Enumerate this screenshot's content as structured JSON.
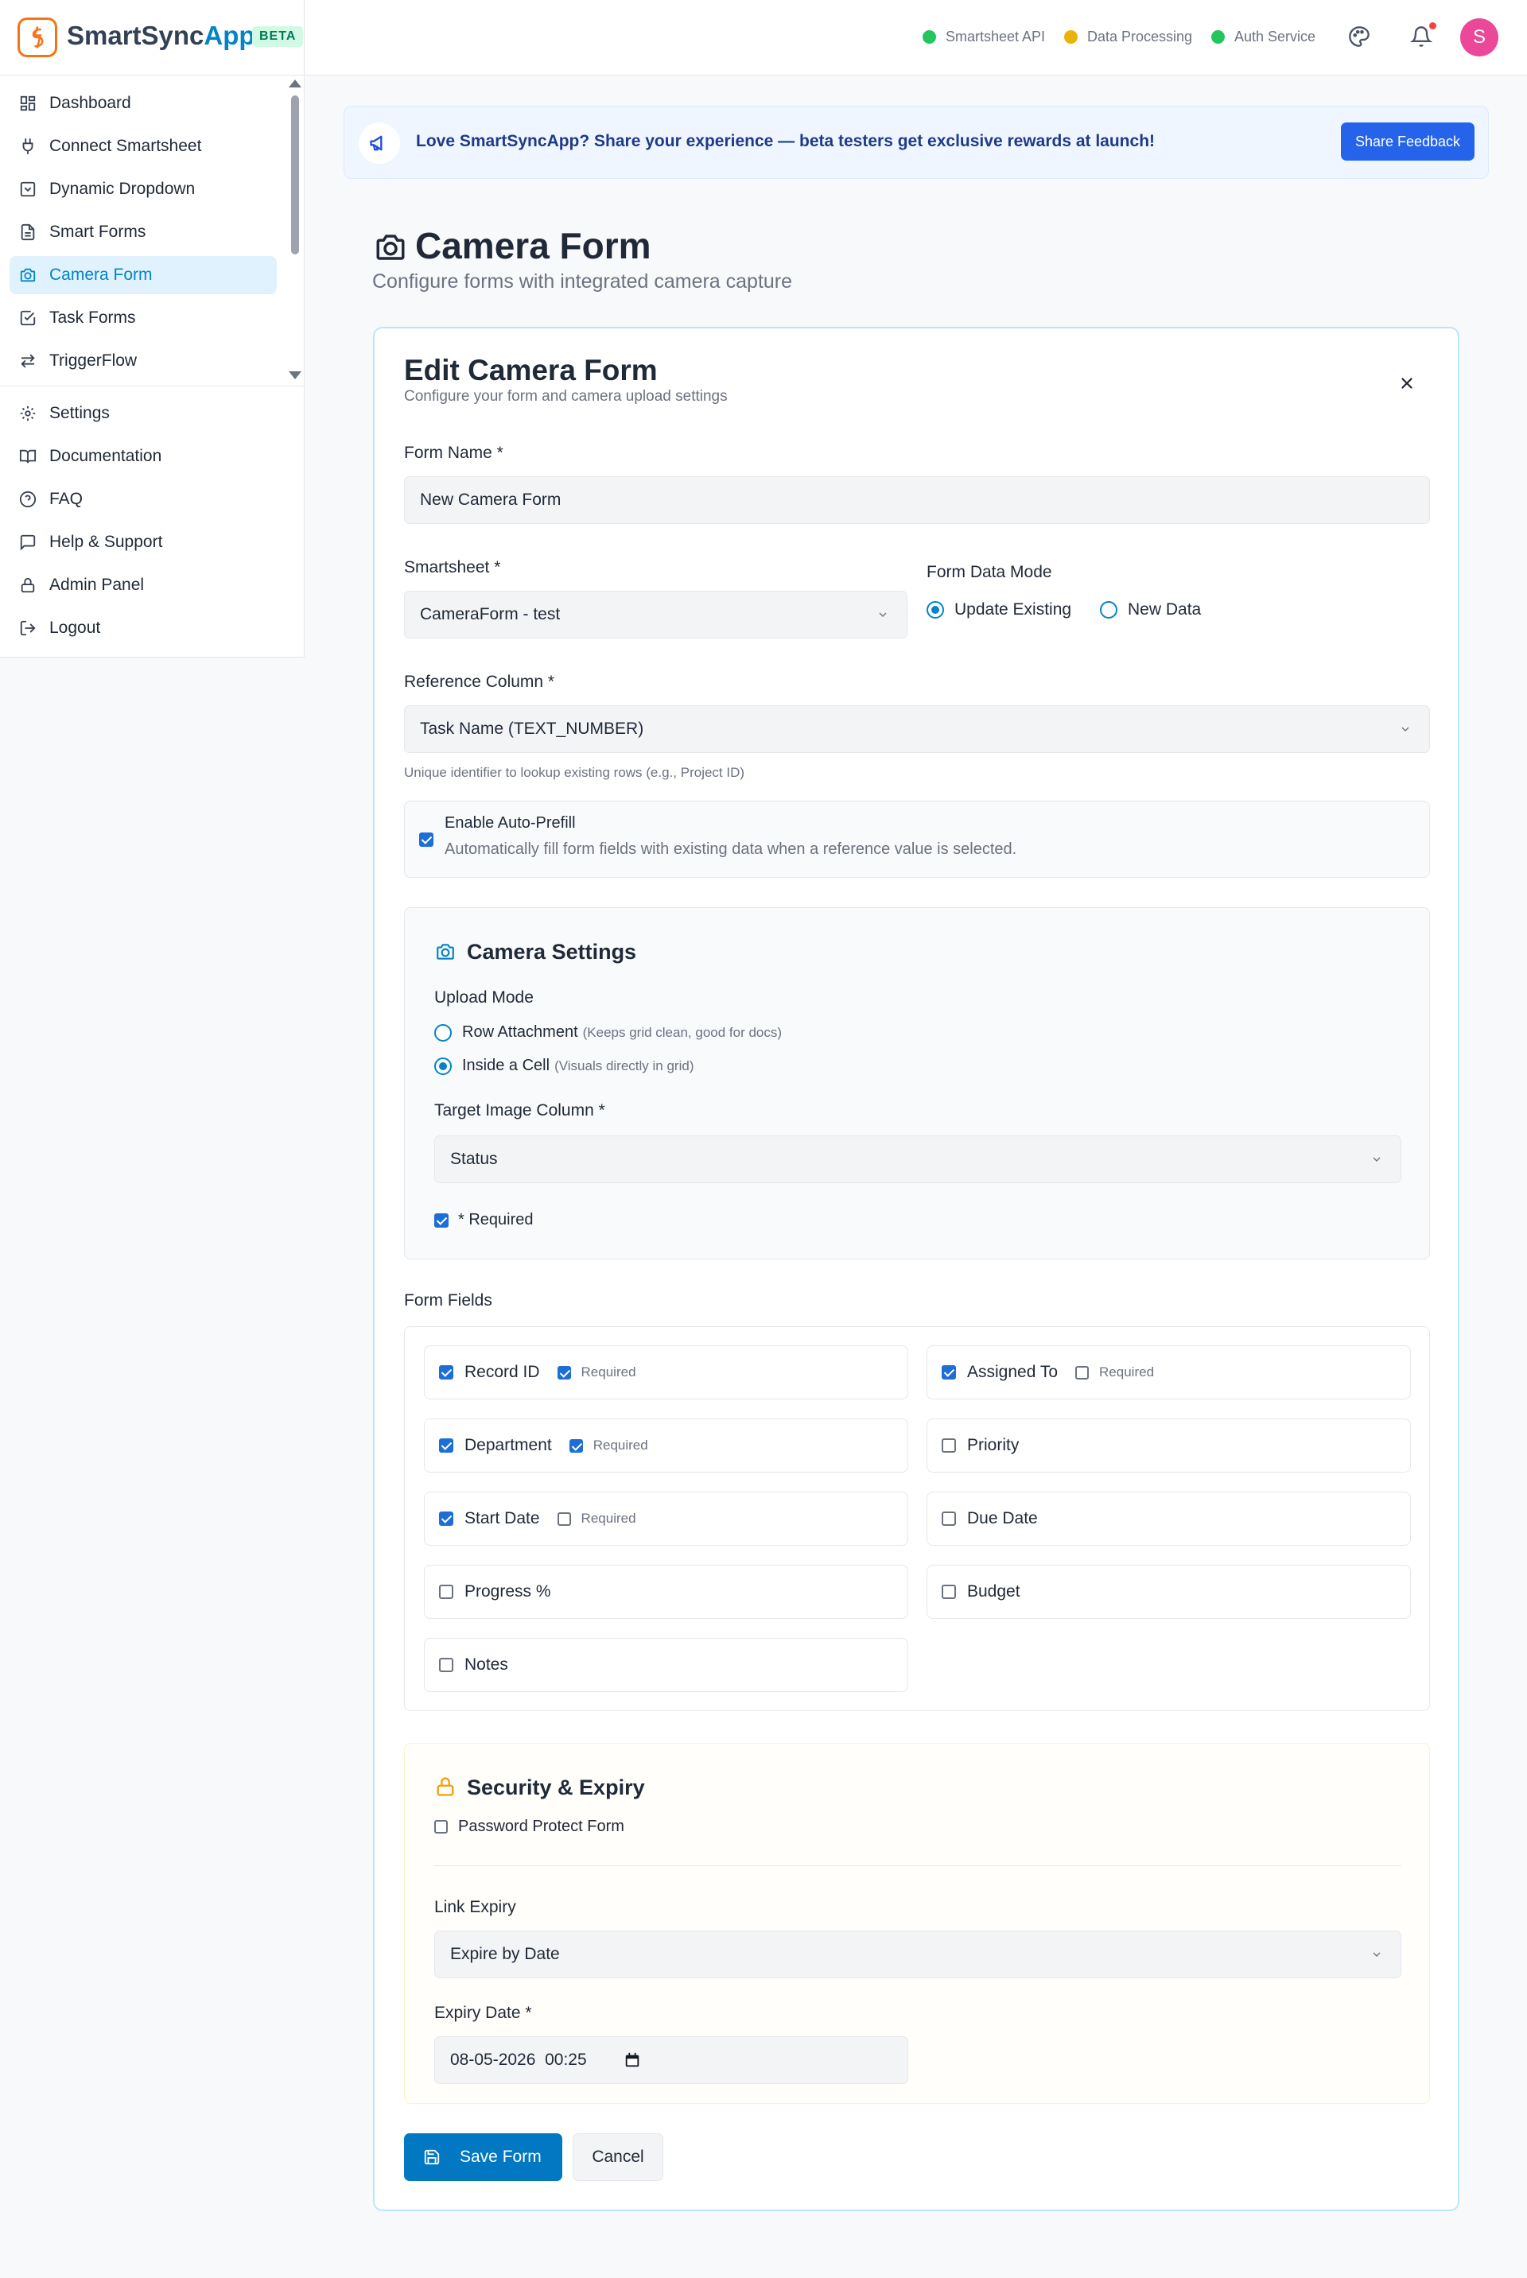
{
  "app": {
    "name_part1": "SmartSync",
    "name_part2": "App",
    "badge": "BETA"
  },
  "sidebar": {
    "primary": [
      {
        "label": "Dashboard",
        "icon": "dashboard-icon"
      },
      {
        "label": "Connect Smartsheet",
        "icon": "plug-icon"
      },
      {
        "label": "Dynamic Dropdown",
        "icon": "dropdown-icon"
      },
      {
        "label": "Smart Forms",
        "icon": "document-icon"
      },
      {
        "label": "Camera Form",
        "icon": "camera-icon",
        "active": true
      },
      {
        "label": "Task Forms",
        "icon": "task-icon"
      },
      {
        "label": "TriggerFlow",
        "icon": "arrows-icon"
      }
    ],
    "secondary": [
      {
        "label": "Settings",
        "icon": "gear-icon"
      },
      {
        "label": "Documentation",
        "icon": "book-icon"
      },
      {
        "label": "FAQ",
        "icon": "help-circle-icon"
      },
      {
        "label": "Help & Support",
        "icon": "chat-icon"
      },
      {
        "label": "Admin Panel",
        "icon": "lock-icon"
      },
      {
        "label": "Logout",
        "icon": "logout-icon"
      }
    ]
  },
  "topbar": {
    "statuses": [
      {
        "label": "Smartsheet API",
        "color": "#22c55e"
      },
      {
        "label": "Data Processing",
        "color": "#eab308"
      },
      {
        "label": "Auth Service",
        "color": "#22c55e"
      }
    ],
    "avatar_initial": "S"
  },
  "banner": {
    "text": "Love SmartSyncApp? Share your experience — beta testers get exclusive rewards at launch!",
    "button": "Share Feedback"
  },
  "page": {
    "title": "Camera Form",
    "subtitle": "Configure forms with integrated camera capture"
  },
  "form": {
    "title": "Edit Camera Form",
    "subtitle": "Configure your form and camera upload settings",
    "form_name_label": "Form Name *",
    "form_name_value": "New Camera Form",
    "smartsheet_label": "Smartsheet *",
    "smartsheet_value": "CameraForm - test",
    "data_mode_label": "Form Data Mode",
    "data_mode_options": [
      "Update Existing",
      "New Data"
    ],
    "data_mode_selected": "Update Existing",
    "reference_label": "Reference Column *",
    "reference_value": "Task Name (TEXT_NUMBER)",
    "reference_hint": "Unique identifier to lookup existing rows (e.g., Project ID)",
    "autoprefill_title": "Enable Auto-Prefill",
    "autoprefill_desc": "Automatically fill form fields with existing data when a reference value is selected.",
    "autoprefill_checked": true
  },
  "camera": {
    "title": "Camera Settings",
    "upload_mode_label": "Upload Mode",
    "upload_modes": [
      {
        "label": "Row Attachment",
        "hint": "(Keeps grid clean, good for docs)",
        "selected": false
      },
      {
        "label": "Inside a Cell",
        "hint": "(Visuals directly in grid)",
        "selected": true
      }
    ],
    "target_label": "Target Image Column *",
    "target_value": "Status",
    "required_label": "* Required",
    "required_checked": true
  },
  "fields": {
    "label": "Form Fields",
    "required_text": "Required",
    "items": [
      {
        "label": "Record ID",
        "checked": true,
        "required": true
      },
      {
        "label": "Assigned To",
        "checked": true,
        "required": false
      },
      {
        "label": "Department",
        "checked": true,
        "required": true
      },
      {
        "label": "Priority",
        "checked": false
      },
      {
        "label": "Start Date",
        "checked": true,
        "required": false
      },
      {
        "label": "Due Date",
        "checked": false
      },
      {
        "label": "Progress %",
        "checked": false
      },
      {
        "label": "Budget",
        "checked": false
      },
      {
        "label": "Notes",
        "checked": false
      }
    ]
  },
  "security": {
    "title": "Security & Expiry",
    "password_label": "Password Protect Form",
    "password_checked": false,
    "link_expiry_label": "Link Expiry",
    "link_expiry_value": "Expire by Date",
    "expiry_date_label": "Expiry Date *",
    "expiry_date_value": "08-05-2026  00:25"
  },
  "actions": {
    "save": "Save Form",
    "cancel": "Cancel"
  },
  "colors": {
    "accent": "#0284c7",
    "brand_orange": "#f97316",
    "primary_button": "#0277c2"
  }
}
